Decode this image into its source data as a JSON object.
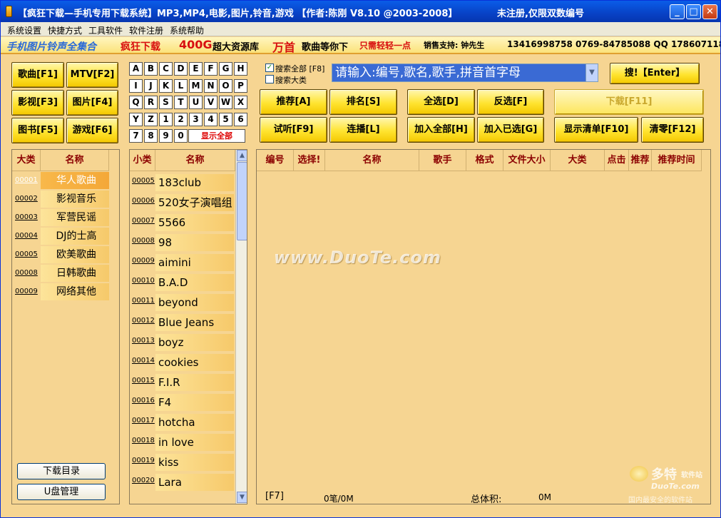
{
  "window": {
    "title": "【疯狂下载—手机专用下载系统】MP3,MP4,电影,图片,铃音,游戏 【作者:陈刚 V8.10 @2003-2008】",
    "status_text": "未注册,仅限双数编号"
  },
  "menu": [
    "系统设置",
    "快捷方式",
    "工具软件",
    "软件注册",
    "系统帮助"
  ],
  "banner": {
    "part1": "手机图片铃声全集合",
    "part2": "疯狂下载",
    "part3": "400G",
    "part4": "超大资源库",
    "part5": "万首",
    "part6": "歌曲等你下",
    "part7": "只需轻轻一点",
    "part8": "销售支持: 钟先生",
    "part9": "13416998758 0769-84785088 QQ 178607118"
  },
  "category_buttons": [
    {
      "label": "歌曲[F1]"
    },
    {
      "label": "MTV[F2]"
    },
    {
      "label": "影视[F3]"
    },
    {
      "label": "图片[F4]"
    },
    {
      "label": "图书[F5]"
    },
    {
      "label": "游戏[F6]"
    }
  ],
  "letters": [
    "A",
    "B",
    "C",
    "D",
    "E",
    "F",
    "G",
    "H",
    "I",
    "J",
    "K",
    "L",
    "M",
    "N",
    "O",
    "P",
    "Q",
    "R",
    "S",
    "T",
    "U",
    "V",
    "W",
    "X",
    "Y",
    "Z",
    "1",
    "2",
    "3",
    "4",
    "5",
    "6",
    "7",
    "8",
    "9",
    "0"
  ],
  "show_all": "显示全部",
  "search": {
    "search_all_label": "搜索全部 [F8]",
    "search_all_checked": true,
    "search_category_label": "搜索大类",
    "search_category_checked": false,
    "placeholder": "请输入:编号,歌名,歌手,拼音首字母",
    "button": "搜!【Enter】"
  },
  "actions": {
    "recommend": "推荐[A]",
    "rank": "排名[S]",
    "select_all": "全选[D]",
    "invert": "反选[F]",
    "download": "下载[F11]",
    "preview": "试听[F9]",
    "continuous": "连播[L]",
    "add_all": "加入全部[H]",
    "add_selected": "加入已选[G]",
    "show_list": "显示清单[F10]",
    "clear": "清零[F12]"
  },
  "major": {
    "headers": [
      "大类",
      "名称"
    ],
    "rows": [
      {
        "code": "00001",
        "name": "华人歌曲",
        "selected": true
      },
      {
        "code": "00002",
        "name": "影视音乐"
      },
      {
        "code": "00003",
        "name": "军营民谣"
      },
      {
        "code": "00004",
        "name": "DJ的士高"
      },
      {
        "code": "00005",
        "name": "欧美歌曲"
      },
      {
        "code": "00008",
        "name": "日韩歌曲"
      },
      {
        "code": "00009",
        "name": "网络其他"
      }
    ],
    "download_dir": "下载目录",
    "usb": "U盘管理"
  },
  "minor": {
    "headers": [
      "小类",
      "名称"
    ],
    "rows": [
      {
        "code": "00005",
        "name": "183club"
      },
      {
        "code": "00006",
        "name": "520女子演唱组"
      },
      {
        "code": "00007",
        "name": "5566"
      },
      {
        "code": "00008",
        "name": "98"
      },
      {
        "code": "00009",
        "name": "aimini"
      },
      {
        "code": "00010",
        "name": "B.A.D"
      },
      {
        "code": "00011",
        "name": "beyond"
      },
      {
        "code": "00012",
        "name": "Blue Jeans"
      },
      {
        "code": "00013",
        "name": "boyz"
      },
      {
        "code": "00014",
        "name": "cookies"
      },
      {
        "code": "00015",
        "name": "F.I.R"
      },
      {
        "code": "00016",
        "name": "F4"
      },
      {
        "code": "00017",
        "name": "hotcha"
      },
      {
        "code": "00018",
        "name": "in love"
      },
      {
        "code": "00019",
        "name": "kiss"
      },
      {
        "code": "00020",
        "name": "Lara"
      }
    ]
  },
  "results": {
    "headers": [
      "编号",
      "选择!",
      "名称",
      "歌手",
      "格式",
      "文件大小",
      "大类",
      "点击",
      "推荐",
      "推荐时间"
    ],
    "status_key": "[F7]",
    "count": "0笔/0M",
    "total_label": "总体积:",
    "total_value": "0M"
  },
  "watermark": "www.DuoTe.com",
  "logo": {
    "line1": "多特",
    "line2": "软件站",
    "line3": "DuoTe.com",
    "line4": "国内最安全的软件站"
  },
  "colors": {
    "accent": "#ffe430",
    "panel": "#f6d592",
    "header_text": "#8b0000",
    "title_bar": "#0842c6"
  }
}
